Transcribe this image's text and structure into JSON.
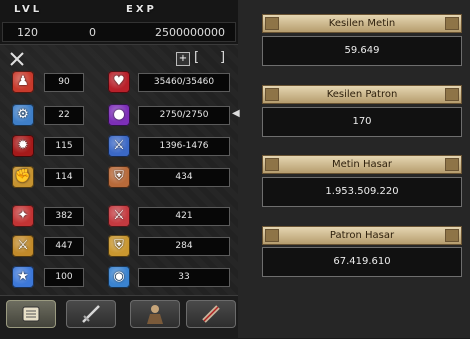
{
  "header": {
    "lvl_label": "LVL",
    "exp_label": "EXP",
    "level": "120",
    "exp_current": "0",
    "exp_required": "2500000000"
  },
  "stats": [
    {
      "icon": "strength-figure-icon",
      "value": "90",
      "color": "#c83a2c"
    },
    {
      "icon": "heart-icon",
      "value": "35460/35460",
      "color": "#b8202a"
    },
    {
      "icon": "intelligence-icon",
      "value": "22",
      "color": "#3f7fc8"
    },
    {
      "icon": "mana-drop-icon",
      "value": "2750/2750",
      "color": "#7d2fb8"
    },
    {
      "icon": "dexterity-icon",
      "value": "115",
      "color": "#a61a1a"
    },
    {
      "icon": "sword-attack-icon",
      "value": "1396-1476",
      "color": "#3b68c6"
    },
    {
      "icon": "vitality-fist-icon",
      "value": "114",
      "color": "#c69330"
    },
    {
      "icon": "shield-defense-icon",
      "value": "434",
      "color": "#b86a3a"
    },
    {
      "icon": "magic-attack-icon",
      "value": "382",
      "color": "#c23434"
    },
    {
      "icon": "magic-sword-icon",
      "value": "421",
      "color": "#c43a40"
    },
    {
      "icon": "golden-sword-icon",
      "value": "447",
      "color": "#c18a2a"
    },
    {
      "icon": "golden-shield-icon",
      "value": "284",
      "color": "#c9972f"
    },
    {
      "icon": "speed-figure-icon",
      "value": "100",
      "color": "#3d78d8"
    },
    {
      "icon": "magic-orb-icon",
      "value": "33",
      "color": "#3a83d0"
    }
  ],
  "toolbar": {
    "plus_label": "+",
    "bracket_open": "[",
    "bracket_close": "]"
  },
  "tabs": [
    {
      "name": "character-tab",
      "icon": "book-icon"
    },
    {
      "name": "skills-tab",
      "icon": "sword-icon"
    },
    {
      "name": "emotion-tab",
      "icon": "person-icon"
    },
    {
      "name": "quest-tab",
      "icon": "scroll-icon"
    }
  ],
  "right_panel": {
    "sections": [
      {
        "title": "Kesilen Metin",
        "value": "59.649"
      },
      {
        "title": "Kesilen Patron",
        "value": "170"
      },
      {
        "title": "Metin Hasar",
        "value": "1.953.509.220"
      },
      {
        "title": "Patron Hasar",
        "value": "67.419.610"
      }
    ]
  },
  "colors": {
    "title_bar": "#d7c49c",
    "panel_bg": "#262626",
    "value_bg": "#111111"
  }
}
